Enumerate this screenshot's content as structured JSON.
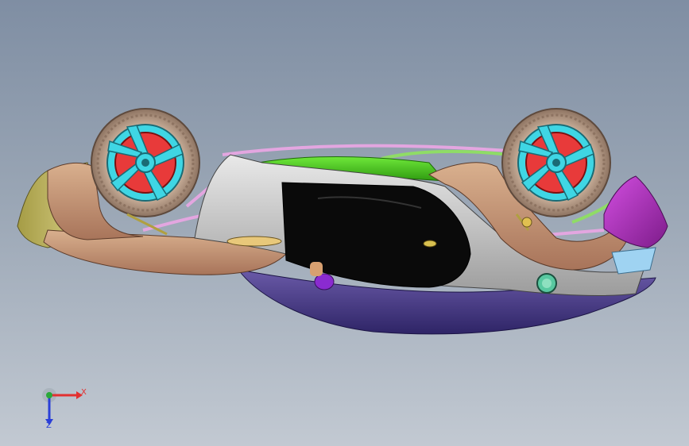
{
  "viewport": {
    "background_top": "#7f8ea3",
    "background_bottom": "#c2c9d2"
  },
  "model": {
    "subject": "car-body-assembly",
    "colors": {
      "tire": "#b49a86",
      "rim": "#3fd6e4",
      "brake_disc": "#e83a3a",
      "body_tan": "#c99d7b",
      "body_gray": "#cfcfcf",
      "door_black": "#0a0a0a",
      "roof_green": "#4bd21c",
      "bumper_magenta": "#b12bc2",
      "underbody_purple": "#4a3a8a",
      "front_yellow": "#c9c06a",
      "frame_pink": "#e3a6e0"
    }
  },
  "triad": {
    "x_label": "X",
    "z_label": "Z",
    "x_color": "#e23030",
    "y_color": "#2aa83a",
    "z_color": "#2a3fd8"
  }
}
